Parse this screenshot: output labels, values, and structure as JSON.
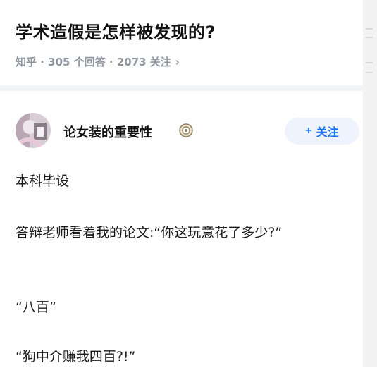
{
  "question": {
    "title": "学术造假是怎样被发现的?",
    "meta": "知乎 · 305 个回答 · 2073 关注",
    "chevron": "›"
  },
  "answer": {
    "author": {
      "name": "论女装的重要性",
      "badge_icon": "badge-icon",
      "avatar_icon": "avatar"
    },
    "follow_button": {
      "plus": "+",
      "label": "关注",
      "color": "#1772f6",
      "background": "#eef3fd"
    },
    "paragraphs": [
      "本科毕设",
      "答辩老师看着我的论文:“你这玩意花了多少?”",
      "“八百”",
      "“狗中介赚我四百?!”"
    ]
  },
  "colors": {
    "text": "#121212",
    "meta": "#8f959e",
    "accent": "#1772f6"
  }
}
